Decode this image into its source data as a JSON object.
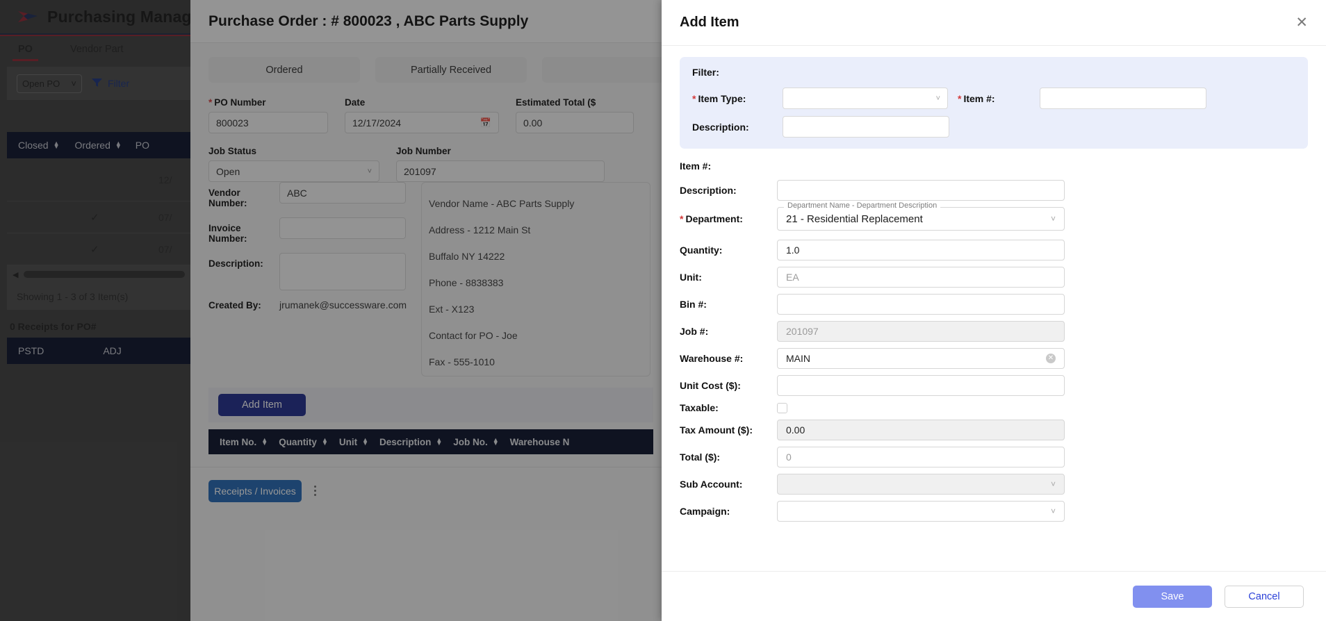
{
  "app": {
    "title": "Purchasing Manag",
    "menu_icon": "hamburger-icon",
    "logo_icon": "arrow-logo-icon",
    "tabs": [
      {
        "label": "PO",
        "active": true
      },
      {
        "label": "Vendor Part",
        "active": false
      }
    ],
    "toolbar": {
      "view_select": "Open PO",
      "filter_label": "Filter",
      "filter_icon": "funnel-icon"
    },
    "po_grid": {
      "columns": [
        "Closed",
        "Ordered",
        "PO"
      ],
      "rows": [
        {
          "closed": "",
          "ordered": "",
          "po_date": "12/"
        },
        {
          "closed": "",
          "ordered": "✓",
          "po_date": "07/"
        },
        {
          "closed": "",
          "ordered": "✓",
          "po_date": "07/"
        }
      ],
      "showing": "Showing 1 - 3 of 3 Item(s)"
    },
    "receipts": {
      "title": "0 Receipts for PO#",
      "columns": [
        "PSTD",
        "ADJ"
      ]
    }
  },
  "po_panel": {
    "heading": "Purchase Order : # 800023 , ABC Parts Supply",
    "status_tabs": [
      "Ordered",
      "Partially Received",
      ""
    ],
    "fields": {
      "po_number_label": "PO Number",
      "po_number_value": "800023",
      "date_label": "Date",
      "date_value": "12/17/2024",
      "date_icon": "calendar-icon",
      "estimated_total_label": "Estimated Total ($",
      "estimated_total_value": "0.00",
      "job_status_label": "Job Status",
      "job_status_value": "Open",
      "job_number_label": "Job Number",
      "job_number_value": "201097",
      "vendor_number_label": "Vendor Number:",
      "vendor_number_value": "ABC",
      "invoice_number_label": "Invoice Number:",
      "invoice_number_value": "",
      "description_label": "Description:",
      "description_value": "",
      "created_by_label": "Created By:",
      "created_by_value": "jrumanek@successware.com"
    },
    "vendor_card": [
      "Vendor Name - ABC Parts Supply",
      "Address - 1212 Main St",
      "Buffalo NY 14222",
      "Phone - 8838383",
      "Ext - X123",
      "Contact for PO - Joe",
      "Fax - 555-1010"
    ],
    "add_item_button": "Add Item",
    "items_columns": [
      "Item No.",
      "Quantity",
      "Unit",
      "Description",
      "Job No.",
      "Warehouse N"
    ],
    "receipts_invoices_button": "Receipts / Invoices",
    "kebab_icon": "kebab-menu-icon"
  },
  "modal": {
    "title": "Add Item",
    "close_icon": "close-icon",
    "filter": {
      "title": "Filter:",
      "item_type_label": "Item Type:",
      "item_type_value": "",
      "item_no_label": "Item #:",
      "item_no_value": "",
      "description_label": "Description:",
      "description_value": ""
    },
    "form": [
      {
        "label": "Item #:",
        "value": "",
        "type": "label-only"
      },
      {
        "label": "Description:",
        "value": "",
        "type": "text"
      },
      {
        "label": "Department:",
        "value": "21 - Residential Replacement",
        "type": "select-float",
        "float_label": "Department Name - Department Description",
        "required": true
      },
      {
        "label": "Quantity:",
        "value": "1.0",
        "type": "text"
      },
      {
        "label": "Unit:",
        "value": "EA",
        "type": "text-placeholder"
      },
      {
        "label": "Bin #:",
        "value": "",
        "type": "text"
      },
      {
        "label": "Job #:",
        "value": "201097",
        "type": "text-disabled"
      },
      {
        "label": "Warehouse #:",
        "value": "MAIN",
        "type": "text-clear"
      },
      {
        "label": "Unit Cost ($):",
        "value": "",
        "type": "text"
      },
      {
        "label": "Taxable:",
        "value": "",
        "type": "checkbox"
      },
      {
        "label": "Tax Amount ($):",
        "value": "0.00",
        "type": "text-disabled"
      },
      {
        "label": "Total ($):",
        "value": "0",
        "type": "text-placeholder"
      },
      {
        "label": "Sub Account:",
        "value": "",
        "type": "select-disabled"
      },
      {
        "label": "Campaign:",
        "value": "",
        "type": "select"
      }
    ],
    "required_marker": "*",
    "footer": {
      "save_label": "Save",
      "cancel_label": "Cancel"
    }
  },
  "colors": {
    "navy_header": "#091028",
    "accent_red": "#8e2430",
    "primary_blue": "#1e2a8c",
    "link_blue": "#2b41d8",
    "save_blue": "#8190ef",
    "filter_bg": "#eaeefb"
  }
}
